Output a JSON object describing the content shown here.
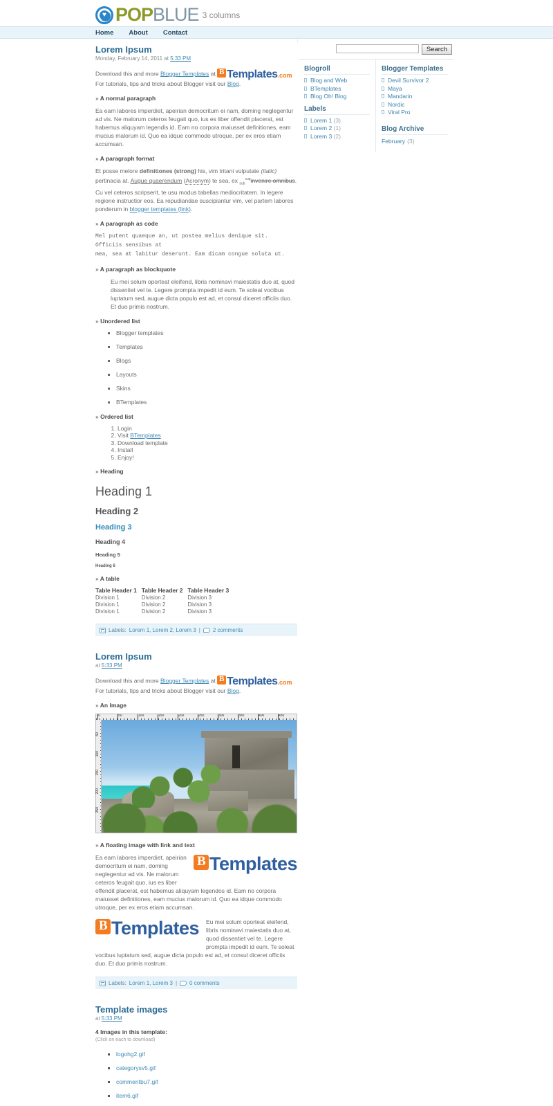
{
  "brand": {
    "pop": "POP",
    "blue": "BLUE",
    "tagline": "3 columns",
    "icon": "heart-circle-icon",
    "pop_color": "#8d9a2a",
    "blue_color": "#7d95a6",
    "accent": "#3f8ab5"
  },
  "nav": {
    "items": [
      {
        "label": "Home"
      },
      {
        "label": "About"
      },
      {
        "label": "Contact"
      }
    ]
  },
  "search": {
    "value": "",
    "placeholder": "",
    "button_label": "Search"
  },
  "sidebar": {
    "col1": {
      "blogroll": {
        "title": "Blogroll",
        "items": [
          {
            "label": "Blog and Web"
          },
          {
            "label": "BTemplates"
          },
          {
            "label": "Blog Oh! Blog"
          }
        ]
      },
      "labels": {
        "title": "Labels",
        "items": [
          {
            "label": "Lorem 1",
            "count": "(3)"
          },
          {
            "label": "Lorem 2",
            "count": "(1)"
          },
          {
            "label": "Lorem 3",
            "count": "(2)"
          }
        ]
      }
    },
    "col2": {
      "templates": {
        "title": "Blogger Templates",
        "items": [
          {
            "label": "Devil Survivor 2"
          },
          {
            "label": "Maya"
          },
          {
            "label": "Mandarin"
          },
          {
            "label": "Nordic"
          },
          {
            "label": "Viral Pro"
          }
        ]
      },
      "archive": {
        "title": "Blog Archive",
        "items": [
          {
            "label": "February",
            "count": "(3)"
          }
        ]
      }
    }
  },
  "post1": {
    "title": "Lorem Ipsum",
    "meta_prefix": "Monday, February 14, 2011 at ",
    "meta_time": "5:33 PM",
    "intro": {
      "pre": "Download this and more ",
      "link1": "Blogger Templates",
      "mid": " at ",
      "logo_b": "B",
      "logo_word": "Templates",
      "logo_com": ".com",
      "post": " For tutorials, tips and tricks about Blogger visit our ",
      "link2": "Blog",
      "end": "."
    },
    "h_normal": "A normal paragraph",
    "p_normal": "Ea eam labores imperdiet, apeirian democritum ei nam, doming neglegentur ad vis. Ne malorum ceteros feugait quo, ius es liber offendit placerat, est habemus aliquyam legendis id. Eam no corpora maiusset definitiones, eam mucius malorum id. Quo ea idque commodo utroque, per ex eros etiam accumsan.",
    "h_format": "A paragraph format",
    "fmt": {
      "a": "Et posse melore ",
      "strong": "definitiones (strong)",
      "b": " his, vim tritani vulputate ",
      "italic": "(italic)",
      "c": " pertinacia at. ",
      "u": "Augue quaerendum",
      "d": " (",
      "acronym": "Acronym",
      "e": ") te sea, ex ",
      "sub": "sub",
      "sup": "sup",
      "del": "invenire omnibus",
      "f": ". Cu vel ceteros scripserit, te usu modus tabellas mediocritatem. In legere regione instructior eos. Ea repudiandae suscipiantur vim, vel partem labores ponderum in ",
      "link": "blogger templates (link)",
      "g": "."
    },
    "h_code": "A paragraph as code",
    "code": "Mel putent quaeque an, ut postea melius denique sit. Officiis sensibus at\nmea, sea at labitur deserunt. Eam dicam congue soluta ut.",
    "h_quote": "A paragraph as blockquote",
    "quote": "Eu mei solum oporteat eleifend, libris nominavi maiestatis duo at, quod dissentiet vel te. Legere prompta impedit id eum. Te soleat vocibus luptatum sed, augue dicta populo est ad, et consul diceret officiis duo. Et duo primis nostrum.",
    "h_ul": "Unordered list",
    "ul": [
      "Blogger templates",
      "Templates",
      "Blogs",
      "Layouts",
      "Skins",
      "BTemplates"
    ],
    "h_ol": "Ordered list",
    "ol": [
      {
        "pre": "Login",
        "link": "",
        "post": ""
      },
      {
        "pre": "Visit ",
        "link": "BTemplates",
        "post": ""
      },
      {
        "pre": "Download template",
        "link": "",
        "post": ""
      },
      {
        "pre": "Install",
        "link": "",
        "post": ""
      },
      {
        "pre": "Enjoy!",
        "link": "",
        "post": ""
      }
    ],
    "h_heading": "Heading",
    "headings": {
      "h1": "Heading 1",
      "h2": "Heading 2",
      "h3": "Heading 3",
      "h4": "Heading 4",
      "h5": "Heading 5",
      "h6": "Heading 6"
    },
    "h_table": "A table",
    "table": {
      "headers": [
        "Table Header 1",
        "Table Header 2",
        "Table Header 3"
      ],
      "rows": [
        [
          "Division 1",
          "Division 2",
          "Division 3"
        ],
        [
          "Division 1",
          "Division 2",
          "Division 3"
        ],
        [
          "Division 1",
          "Division 2",
          "Division 3"
        ]
      ]
    },
    "footer": {
      "labels_prefix": "Labels: ",
      "labels": "Lorem 1, Lorem 2, Lorem 3",
      "separator": "|",
      "comments": "2 comments"
    }
  },
  "post2": {
    "title": "Lorem Ipsum",
    "meta_prefix": "at ",
    "meta_time": "5:33 PM",
    "intro": {
      "pre": "Download this and more ",
      "link1": "Blogger Templates",
      "mid": " at ",
      "logo_b": "B",
      "logo_word": "Templates",
      "logo_com": ".com",
      "post": " For tutorials, tips and tricks about Blogger visit our ",
      "link2": "Blog",
      "end": "."
    },
    "h_image": "An Image",
    "image": {
      "alt": "Mayan ruins at Tulum overlooking turquoise sea",
      "ruler_top_labels": [
        "0",
        "50",
        "100",
        "150",
        "200",
        "250",
        "300",
        "350",
        "400",
        "450"
      ],
      "ruler_left_labels": [
        "50",
        "100",
        "150",
        "200",
        "250",
        "300"
      ]
    },
    "h_float": "A floating image with link and text",
    "p_float1": "Ea eam labores imperdiet, apeirian democritum ei nam, doming neglegentur ad vis. Ne malorum ceteros feugait quo, ius es liber offendit placerat, est habemus aliquyam legendos id. Eam no corpora maiusset definitiones, eam mucius malorum id. Quo ea idque commodo utroque, per ex eros etiam accumsan.",
    "p_float2": "Eu mei solum oporteat eleifend, libris nominavi maiestatis duo at, quod dissentiet vel te. Legere prompta impedit id eum. Te soleat vocibus luptatum sed, augue dicta populo est ad, et consul diceret officiis duo. Et duo primis nostrum.",
    "logo_b": "B",
    "logo_word": "Templates",
    "footer": {
      "labels_prefix": "Labels: ",
      "labels": "Lorem 1, Lorem 3",
      "separator": "|",
      "comments": "0 comments"
    }
  },
  "post3": {
    "title": "Template images",
    "meta_prefix": "at ",
    "meta_time": "5:33 PM",
    "note": "4 Images in this template:",
    "sub_note": "(Click on each to download)",
    "files": [
      {
        "name": "logohg2.gif"
      },
      {
        "name": "categorysv5.gif"
      },
      {
        "name": "commentbu7.gif"
      },
      {
        "name": "item6.gif"
      }
    ]
  }
}
